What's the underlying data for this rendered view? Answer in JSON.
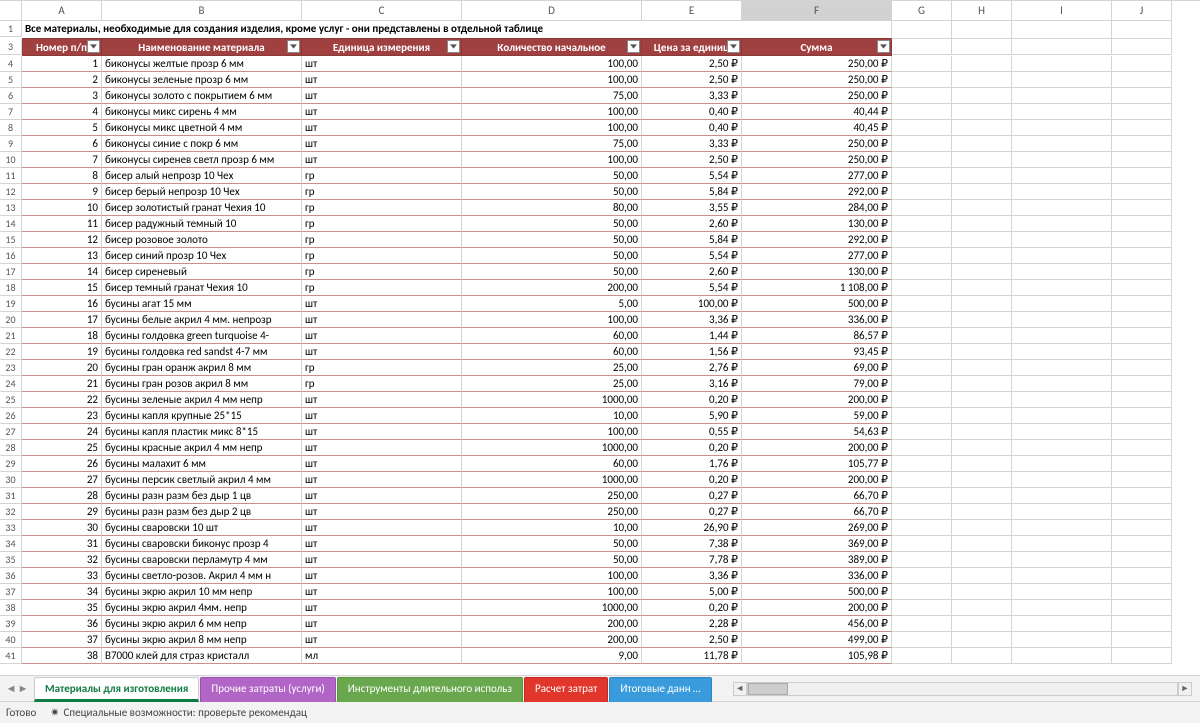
{
  "columns": [
    "A",
    "B",
    "C",
    "D",
    "E",
    "F",
    "G",
    "H",
    "I",
    "J"
  ],
  "selectedCol": "F",
  "titleText": "Все материалы, необходимые для создания изделия, кроме услуг - они представлены в отдельной таблице",
  "headers": {
    "num": "Номер п/п",
    "name": "Наименование материала",
    "unit": "Единица измерения",
    "qty": "Количество начальное",
    "price": "Цена за единиц",
    "sum": "Сумма"
  },
  "rows": [
    {
      "rn": 4,
      "n": 1,
      "name": "биконусы желтые прозр 6 мм",
      "u": "шт",
      "q": "100,00",
      "p": "2,50 ₽",
      "s": "250,00 ₽"
    },
    {
      "rn": 5,
      "n": 2,
      "name": "биконусы зеленые прозр 6 мм",
      "u": "шт",
      "q": "100,00",
      "p": "2,50 ₽",
      "s": "250,00 ₽"
    },
    {
      "rn": 6,
      "n": 3,
      "name": "биконусы золото с покрытием 6 мм",
      "u": "шт",
      "q": "75,00",
      "p": "3,33 ₽",
      "s": "250,00 ₽"
    },
    {
      "rn": 7,
      "n": 4,
      "name": "биконусы микс сирень 4 мм",
      "u": "шт",
      "q": "100,00",
      "p": "0,40 ₽",
      "s": "40,44 ₽"
    },
    {
      "rn": 8,
      "n": 5,
      "name": "биконусы микс цветной 4 мм",
      "u": "шт",
      "q": "100,00",
      "p": "0,40 ₽",
      "s": "40,45 ₽"
    },
    {
      "rn": 9,
      "n": 6,
      "name": "биконусы синие с покр 6 мм",
      "u": "шт",
      "q": "75,00",
      "p": "3,33 ₽",
      "s": "250,00 ₽"
    },
    {
      "rn": 10,
      "n": 7,
      "name": "биконусы сиренев светл прозр 6 мм",
      "u": "шт",
      "q": "100,00",
      "p": "2,50 ₽",
      "s": "250,00 ₽"
    },
    {
      "rn": 11,
      "n": 8,
      "name": "бисер алый непрозр 10 Чех",
      "u": "гр",
      "q": "50,00",
      "p": "5,54 ₽",
      "s": "277,00 ₽"
    },
    {
      "rn": 12,
      "n": 9,
      "name": "бисер берый непрозр 10 Чех",
      "u": "гр",
      "q": "50,00",
      "p": "5,84 ₽",
      "s": "292,00 ₽"
    },
    {
      "rn": 13,
      "n": 10,
      "name": "бисер золотистый гранат Чехия 10",
      "u": "гр",
      "q": "80,00",
      "p": "3,55 ₽",
      "s": "284,00 ₽"
    },
    {
      "rn": 14,
      "n": 11,
      "name": "бисер радужный темный 10",
      "u": "гр",
      "q": "50,00",
      "p": "2,60 ₽",
      "s": "130,00 ₽"
    },
    {
      "rn": 15,
      "n": 12,
      "name": "бисер розовое золото",
      "u": "гр",
      "q": "50,00",
      "p": "5,84 ₽",
      "s": "292,00 ₽"
    },
    {
      "rn": 16,
      "n": 13,
      "name": "бисер синий прозр 10 Чех",
      "u": "гр",
      "q": "50,00",
      "p": "5,54 ₽",
      "s": "277,00 ₽"
    },
    {
      "rn": 17,
      "n": 14,
      "name": "бисер сиреневый",
      "u": "гр",
      "q": "50,00",
      "p": "2,60 ₽",
      "s": "130,00 ₽"
    },
    {
      "rn": 18,
      "n": 15,
      "name": "бисер темный гранат Чехия 10",
      "u": "гр",
      "q": "200,00",
      "p": "5,54 ₽",
      "s": "1 108,00 ₽"
    },
    {
      "rn": 19,
      "n": 16,
      "name": "бусины агат 15 мм",
      "u": "шт",
      "q": "5,00",
      "p": "100,00 ₽",
      "s": "500,00 ₽"
    },
    {
      "rn": 20,
      "n": 17,
      "name": "бусины белые акрил 4 мм. непрозр",
      "u": "шт",
      "q": "100,00",
      "p": "3,36 ₽",
      "s": "336,00 ₽"
    },
    {
      "rn": 21,
      "n": 18,
      "name": "бусины голдовка green turquoise 4-",
      "u": "шт",
      "q": "60,00",
      "p": "1,44 ₽",
      "s": "86,57 ₽"
    },
    {
      "rn": 22,
      "n": 19,
      "name": "бусины голдовка red sandst 4-7 мм",
      "u": "шт",
      "q": "60,00",
      "p": "1,56 ₽",
      "s": "93,45 ₽"
    },
    {
      "rn": 23,
      "n": 20,
      "name": "бусины гран оранж акрил 8 мм",
      "u": "гр",
      "q": "25,00",
      "p": "2,76 ₽",
      "s": "69,00 ₽"
    },
    {
      "rn": 24,
      "n": 21,
      "name": "бусины гран розов акрил 8 мм",
      "u": "гр",
      "q": "25,00",
      "p": "3,16 ₽",
      "s": "79,00 ₽"
    },
    {
      "rn": 25,
      "n": 22,
      "name": "бусины зеленые акрил 4 мм непр",
      "u": "шт",
      "q": "1000,00",
      "p": "0,20 ₽",
      "s": "200,00 ₽"
    },
    {
      "rn": 26,
      "n": 23,
      "name": "бусины капля крупные 25*15",
      "u": "шт",
      "q": "10,00",
      "p": "5,90 ₽",
      "s": "59,00 ₽"
    },
    {
      "rn": 27,
      "n": 24,
      "name": "бусины капля пластик микс 8*15",
      "u": "шт",
      "q": "100,00",
      "p": "0,55 ₽",
      "s": "54,63 ₽"
    },
    {
      "rn": 28,
      "n": 25,
      "name": "бусины красные акрил 4 мм непр",
      "u": "шт",
      "q": "1000,00",
      "p": "0,20 ₽",
      "s": "200,00 ₽"
    },
    {
      "rn": 29,
      "n": 26,
      "name": "бусины малахит 6 мм",
      "u": "шт",
      "q": "60,00",
      "p": "1,76 ₽",
      "s": "105,77 ₽"
    },
    {
      "rn": 30,
      "n": 27,
      "name": "бусины персик светлый акрил 4 мм",
      "u": "шт",
      "q": "1000,00",
      "p": "0,20 ₽",
      "s": "200,00 ₽"
    },
    {
      "rn": 31,
      "n": 28,
      "name": "бусины разн разм без дыр 1 цв",
      "u": "шт",
      "q": "250,00",
      "p": "0,27 ₽",
      "s": "66,70 ₽"
    },
    {
      "rn": 32,
      "n": 29,
      "name": "бусины разн разм без дыр 2 цв",
      "u": "шт",
      "q": "250,00",
      "p": "0,27 ₽",
      "s": "66,70 ₽"
    },
    {
      "rn": 33,
      "n": 30,
      "name": "бусины сваровски 10 шт",
      "u": "шт",
      "q": "10,00",
      "p": "26,90 ₽",
      "s": "269,00 ₽"
    },
    {
      "rn": 34,
      "n": 31,
      "name": "бусины сваровски биконус прозр 4",
      "u": "шт",
      "q": "50,00",
      "p": "7,38 ₽",
      "s": "369,00 ₽"
    },
    {
      "rn": 35,
      "n": 32,
      "name": "бусины сваровски перламутр 4 мм",
      "u": "шт",
      "q": "50,00",
      "p": "7,78 ₽",
      "s": "389,00 ₽"
    },
    {
      "rn": 36,
      "n": 33,
      "name": "бусины светло-розов. Акрил 4 мм н",
      "u": "шт",
      "q": "100,00",
      "p": "3,36 ₽",
      "s": "336,00 ₽"
    },
    {
      "rn": 37,
      "n": 34,
      "name": "бусины экрю акрил 10 мм непр",
      "u": "шт",
      "q": "100,00",
      "p": "5,00 ₽",
      "s": "500,00 ₽"
    },
    {
      "rn": 38,
      "n": 35,
      "name": "бусины экрю акрил 4мм. непр",
      "u": "шт",
      "q": "1000,00",
      "p": "0,20 ₽",
      "s": "200,00 ₽"
    },
    {
      "rn": 39,
      "n": 36,
      "name": "бусины экрю акрил 6 мм непр",
      "u": "шт",
      "q": "200,00",
      "p": "2,28 ₽",
      "s": "456,00 ₽"
    },
    {
      "rn": 40,
      "n": 37,
      "name": "бусины экрю акрил 8 мм непр",
      "u": "шт",
      "q": "200,00",
      "p": "2,50 ₽",
      "s": "499,00 ₽"
    },
    {
      "rn": 41,
      "n": 38,
      "name": "B7000 клей для страз кристалл",
      "u": "мл",
      "q": "9,00",
      "p": "11,78 ₽",
      "s": "105,98 ₽"
    }
  ],
  "tabs": [
    {
      "label": "Материалы для изготовления",
      "cls": "active"
    },
    {
      "label": "Прочие затраты (услуги)",
      "cls": "purple"
    },
    {
      "label": "Инструменты длительного использ",
      "cls": "green"
    },
    {
      "label": "Расчет затрат",
      "cls": "red"
    },
    {
      "label": "Итоговые данн …",
      "cls": "blue"
    }
  ],
  "status": {
    "ready": "Готово",
    "access": "Специальные возможности: проверьте рекомендац"
  }
}
